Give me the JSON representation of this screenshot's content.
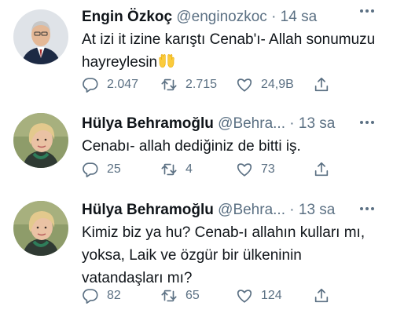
{
  "tweets": [
    {
      "name": "Engin Özkoç",
      "handle": "@enginozkoc",
      "separator": "·",
      "time": "14 sa",
      "text": "At izi it izine karıştı Cenab'ı- Allah sonumuzu hayreylesin",
      "emoji": "open-hands-emoji",
      "replies": "2.047",
      "retweets": "2.715",
      "likes": "24,9B"
    },
    {
      "name": "Hülya Behramoğlu",
      "handle": "@Behra...",
      "separator": "·",
      "time": "13 sa",
      "text": "Cenabı- allah dediğiniz de bitti iş.",
      "replies": "25",
      "retweets": "4",
      "likes": "73"
    },
    {
      "name": "Hülya Behramoğlu",
      "handle": "@Behra...",
      "separator": "·",
      "time": "13 sa",
      "text": "Kimiz biz ya hu? Cenab-ı allahın kulları mı, yoksa, Laik ve özgür bir ülkeninin vatandaşları mı?",
      "replies": "82",
      "retweets": "65",
      "likes": "124"
    }
  ],
  "colors": {
    "text": "#0f1419",
    "secondary": "#5b7083"
  }
}
